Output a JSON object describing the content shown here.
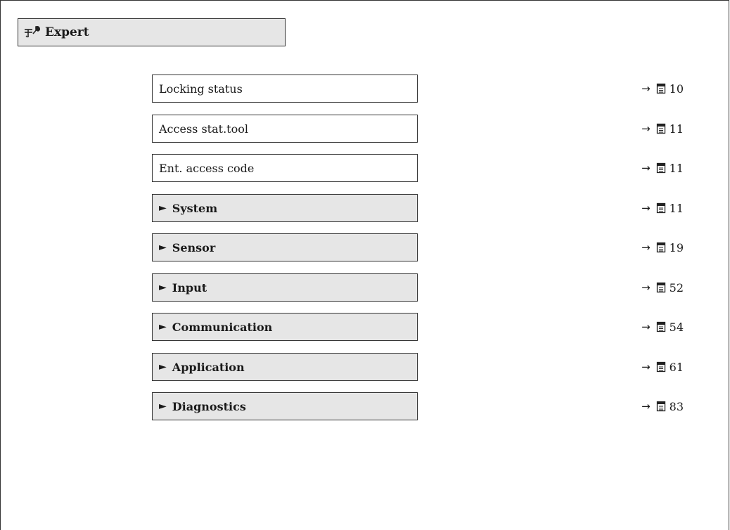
{
  "header": {
    "title": "Expert",
    "icon": "expert-wrench-icon"
  },
  "items": [
    {
      "label": "Locking status",
      "kind": "parameter",
      "page": "10"
    },
    {
      "label": "Access stat.tool",
      "kind": "parameter",
      "page": "11"
    },
    {
      "label": "Ent. access code",
      "kind": "parameter",
      "page": "11"
    },
    {
      "label": "System",
      "kind": "submenu",
      "page": "11"
    },
    {
      "label": "Sensor",
      "kind": "submenu",
      "page": "19"
    },
    {
      "label": "Input",
      "kind": "submenu",
      "page": "52"
    },
    {
      "label": "Communication",
      "kind": "submenu",
      "page": "54"
    },
    {
      "label": "Application",
      "kind": "submenu",
      "page": "61"
    },
    {
      "label": "Diagnostics",
      "kind": "submenu",
      "page": "83"
    }
  ],
  "symbols": {
    "submenu_marker": "►",
    "ref_arrow": "→"
  },
  "colors": {
    "submenu_fill": "#e6e6e6",
    "border": "#333333"
  }
}
